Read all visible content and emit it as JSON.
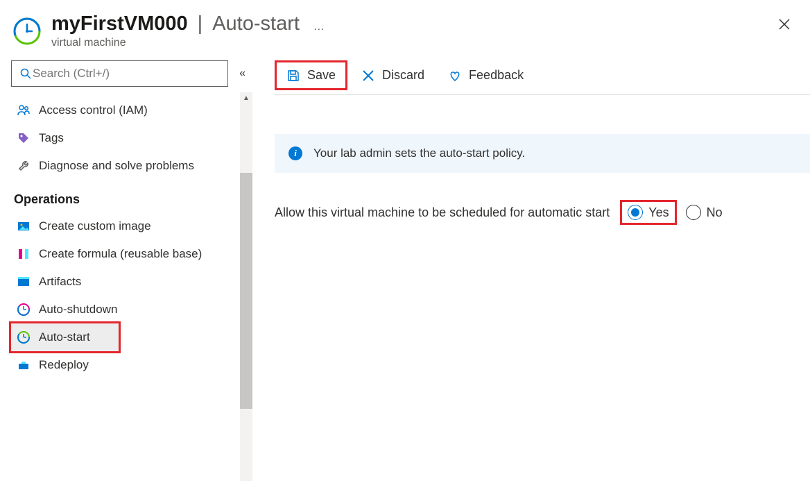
{
  "header": {
    "resource_name": "myFirstVM000",
    "page_title": "Auto-start",
    "subtitle": "virtual machine",
    "more": "…"
  },
  "search": {
    "placeholder": "Search (Ctrl+/)"
  },
  "sidebar": {
    "items": [
      {
        "label": "Access control (IAM)",
        "icon": "people-icon"
      },
      {
        "label": "Tags",
        "icon": "tag-icon"
      },
      {
        "label": "Diagnose and solve problems",
        "icon": "wrench-icon"
      }
    ],
    "section_title": "Operations",
    "ops": [
      {
        "label": "Create custom image",
        "icon": "image-icon"
      },
      {
        "label": "Create formula (reusable base)",
        "icon": "formula-icon"
      },
      {
        "label": "Artifacts",
        "icon": "artifacts-icon"
      },
      {
        "label": "Auto-shutdown",
        "icon": "clock-icon"
      },
      {
        "label": "Auto-start",
        "icon": "clock-green-icon",
        "selected": true
      },
      {
        "label": "Redeploy",
        "icon": "redeploy-icon"
      }
    ]
  },
  "toolbar": {
    "save_label": "Save",
    "discard_label": "Discard",
    "feedback_label": "Feedback"
  },
  "banner": {
    "text": "Your lab admin sets the auto-start policy."
  },
  "form": {
    "label": "Allow this virtual machine to be scheduled for automatic start",
    "yes": "Yes",
    "no": "No",
    "selected": "yes"
  }
}
